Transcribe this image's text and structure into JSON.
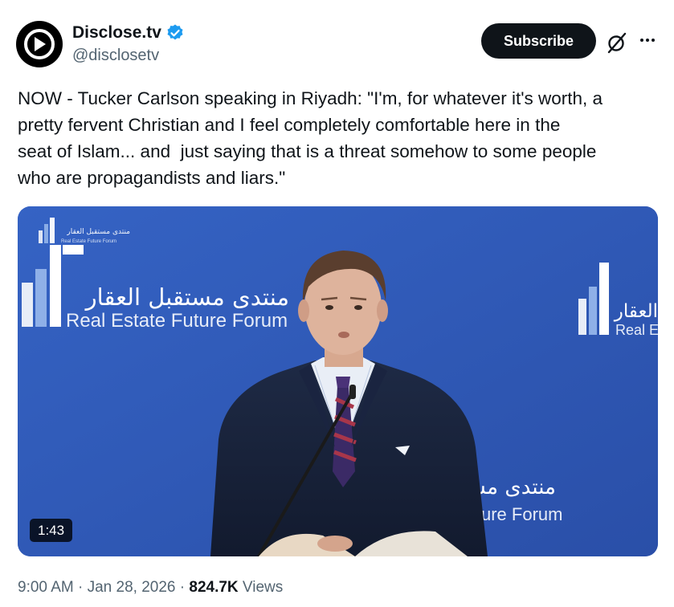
{
  "account": {
    "display_name": "Disclose.tv",
    "handle": "@disclosetv",
    "verified": true,
    "avatar_icon": "disclose-logo-icon"
  },
  "actions": {
    "subscribe_label": "Subscribe",
    "grok_icon": "grok-icon",
    "more_icon": "more-icon"
  },
  "tweet": {
    "text": "NOW - Tucker Carlson speaking in Riyadh: \"I'm, for whatever it's worth, a\npretty fervent Christian and I feel completely comfortable here in the\nseat of Islam... and  just saying that is a threat somehow to some people\nwho are propagandists and liars.\""
  },
  "media": {
    "duration": "1:43",
    "backdrop_arabic": "منتدى مستقبل العقار",
    "backdrop_english": "Real Estate Future Forum",
    "backdrop_right_arabic": "العقار",
    "backdrop_right_english": "Real E",
    "backdrop_lower_arabic": "منتدى مس",
    "backdrop_lower_english": "ure Forum",
    "small_logo_arabic": "منتدى مستقبل العقار",
    "small_logo_english": "Real Estate Future Forum"
  },
  "meta": {
    "time": "9:00 AM",
    "separator": " · ",
    "date": "Jan 28, 2026",
    "views_count": "824.7K",
    "views_label": " Views"
  },
  "colors": {
    "text_primary": "#0f1419",
    "text_secondary": "#536471",
    "verified_blue": "#1d9bf0",
    "backdrop_blue": "#2f57b8"
  }
}
